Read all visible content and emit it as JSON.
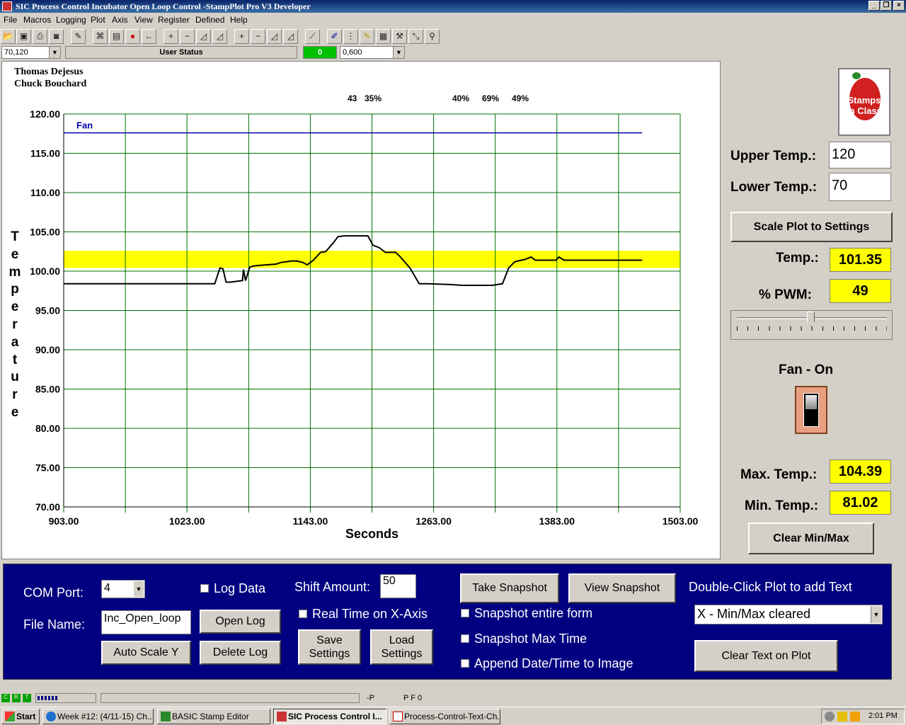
{
  "window": {
    "title": "SIC Process Control Incubator Open Loop Control -StampPlot Pro V3 Developer"
  },
  "menu": [
    "File",
    "Macros",
    "Logging",
    "Plot",
    "Axis",
    "View",
    "Register",
    "Defined",
    "Help"
  ],
  "statusrow": {
    "coords": "70,120",
    "user_status": "User Status",
    "counter": "0",
    "range": "0,600"
  },
  "plot": {
    "authors": [
      "Thomas Dejesus",
      "Chuck Bouchard"
    ],
    "pct_labels": [
      "43",
      "35%",
      "40%",
      "69%",
      "49%"
    ],
    "fan_label": "Fan",
    "xlabel": "Seconds",
    "ylabel_letters": [
      "T",
      "e",
      "m",
      "p",
      "e",
      "r",
      "a",
      "t",
      "u",
      "r",
      "e"
    ]
  },
  "chart_data": {
    "type": "line",
    "ylabel": "Temperature",
    "xlabel": "Seconds",
    "xlim": [
      903,
      1503
    ],
    "ylim": [
      70,
      120
    ],
    "x_ticks": [
      "903.00",
      "1023.00",
      "1143.00",
      "1263.00",
      "1383.00",
      "1503.00"
    ],
    "y_ticks": [
      "120.00",
      "115.00",
      "110.00",
      "105.00",
      "100.00",
      "95.00",
      "90.00",
      "85.00",
      "80.00",
      "75.00",
      "70.00"
    ],
    "band": {
      "low": 100.4,
      "high": 102.6,
      "color": "#ffff00"
    },
    "fan_line": {
      "y": 117.6,
      "x_start": 903,
      "x_end": 1466,
      "color": "#0000aa"
    },
    "series": [
      {
        "color": "#000000",
        "x": [
          903,
          1050,
          1052,
          1055,
          1058,
          1061,
          1065,
          1077,
          1078,
          1080,
          1084,
          1086,
          1090,
          1110,
          1114,
          1125,
          1130,
          1136,
          1140,
          1146,
          1153,
          1158,
          1166,
          1170,
          1176,
          1199,
          1204,
          1210,
          1216,
          1226,
          1230,
          1236,
          1240,
          1249,
          1257,
          1280,
          1290,
          1300,
          1310,
          1320,
          1330,
          1336,
          1342,
          1352,
          1358,
          1362,
          1382,
          1385,
          1390,
          1466
        ],
        "y": [
          98.4,
          98.4,
          99.2,
          100.4,
          100.3,
          98.6,
          98.6,
          98.8,
          100.2,
          98.8,
          100.5,
          100.6,
          100.7,
          100.9,
          101.1,
          101.3,
          101.3,
          101.1,
          100.8,
          101.4,
          102.4,
          102.5,
          103.7,
          104.4,
          104.5,
          104.5,
          103.3,
          103.0,
          102.4,
          102.4,
          101.9,
          101.0,
          100.4,
          98.4,
          98.4,
          98.3,
          98.2,
          98.2,
          98.2,
          98.2,
          98.4,
          100.4,
          101.2,
          101.5,
          101.8,
          101.4,
          101.4,
          101.8,
          101.4,
          101.4
        ]
      }
    ]
  },
  "right": {
    "upper_label": "Upper Temp.:",
    "upper_value": "120",
    "lower_label": "Lower Temp.:",
    "lower_value": "70",
    "scale_button": "Scale Plot to Settings",
    "temp_label": "Temp.:",
    "temp_value": "101.35",
    "pwm_label": "% PWM:",
    "pwm_value": "49",
    "pwm_slider_fraction": 0.49,
    "fan_status": "Fan - On",
    "max_label": "Max. Temp.:",
    "max_value": "104.39",
    "min_label": "Min. Temp.:",
    "min_value": "81.02",
    "clear_minmax": "Clear Min/Max",
    "logo_text": [
      "Stamps",
      "in Class"
    ]
  },
  "bottom": {
    "com_label": "COM Port:",
    "com_value": "4",
    "file_label": "File Name:",
    "file_value": "Inc_Open_loop",
    "log_data": "Log Data",
    "open_log": "Open Log",
    "delete_log": "Delete Log",
    "auto_scale": "Auto Scale Y",
    "shift_label": "Shift Amount:",
    "shift_value": "50",
    "real_time": "Real Time on X-Axis",
    "save_settings": [
      "Save",
      "Settings"
    ],
    "load_settings": [
      "Load",
      "Settings"
    ],
    "take_snapshot": "Take Snapshot",
    "view_snapshot": "View Snapshot",
    "snap_entire": "Snapshot entire form",
    "snap_max": "Snapshot Max Time",
    "append_date": "Append Date/Time to Image",
    "dblclick_text": "Double-Click Plot to add Text",
    "text_select": "X - Min/Max cleared",
    "clear_text": "Clear Text on Plot"
  },
  "statusbar": {
    "p_label": "-P",
    "pf_label": "P F 0"
  },
  "taskbar": {
    "start": "Start",
    "tasks": [
      "Week #12: (4/11-15) Ch...",
      "BASIC Stamp Editor",
      "SIC Process Control I...",
      "Process-Control-Text-Ch..."
    ],
    "clock": "2:01 PM"
  }
}
